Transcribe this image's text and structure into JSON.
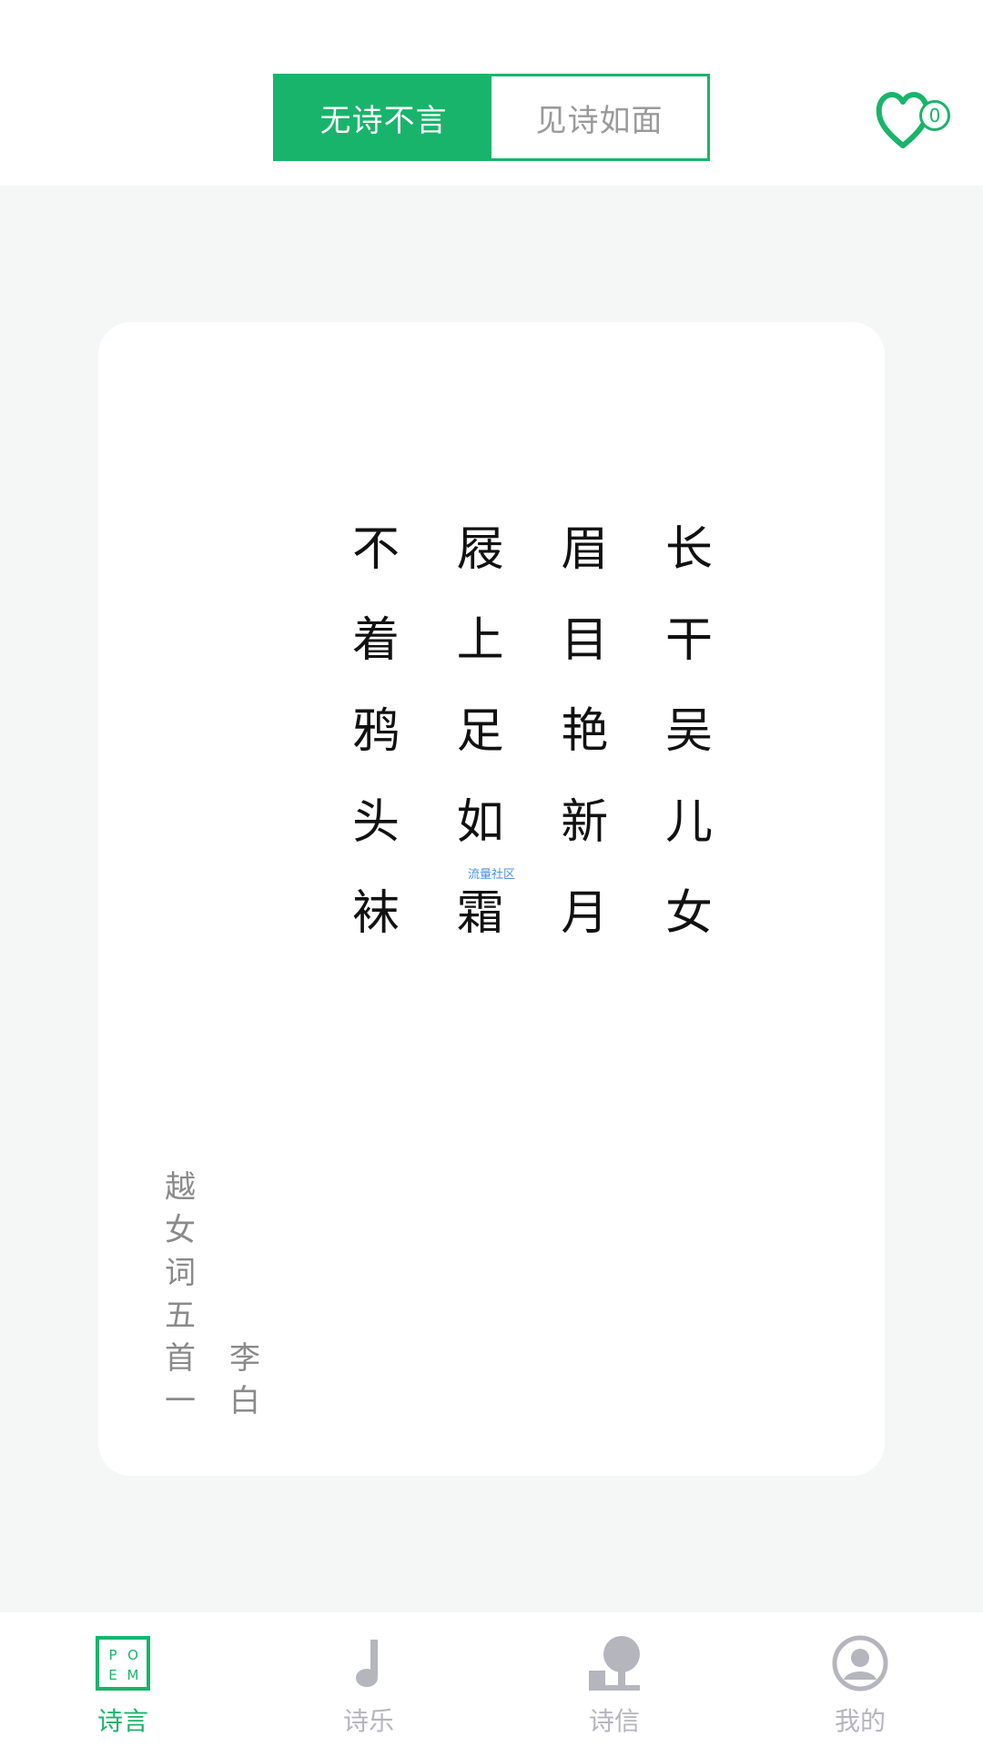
{
  "header": {
    "segments": [
      {
        "label": "无诗不言",
        "active": true
      },
      {
        "label": "见诗如面",
        "active": false
      }
    ],
    "favorites_count": "0",
    "accent_color": "#19b46b"
  },
  "poem": {
    "lines": [
      [
        "长",
        "干",
        "吴",
        "儿",
        "女"
      ],
      [
        "眉",
        "目",
        "艳",
        "新",
        "月"
      ],
      [
        "屐",
        "上",
        "足",
        "如",
        "霜"
      ],
      [
        "不",
        "着",
        "鸦",
        "头",
        "袜"
      ]
    ],
    "title_chars": [
      "越",
      "女",
      "词",
      "五",
      "首",
      "一"
    ],
    "author_chars": [
      "李",
      "白"
    ],
    "watermark": "流量社区"
  },
  "tabbar": {
    "items": [
      {
        "label": "诗言",
        "icon": "poem-logo-icon",
        "active": true
      },
      {
        "label": "诗乐",
        "icon": "music-note-icon",
        "active": false
      },
      {
        "label": "诗信",
        "icon": "mailbox-icon",
        "active": false
      },
      {
        "label": "我的",
        "icon": "user-avatar-icon",
        "active": false
      }
    ],
    "active_color": "#19b46b",
    "inactive_color": "#b5b5be"
  }
}
